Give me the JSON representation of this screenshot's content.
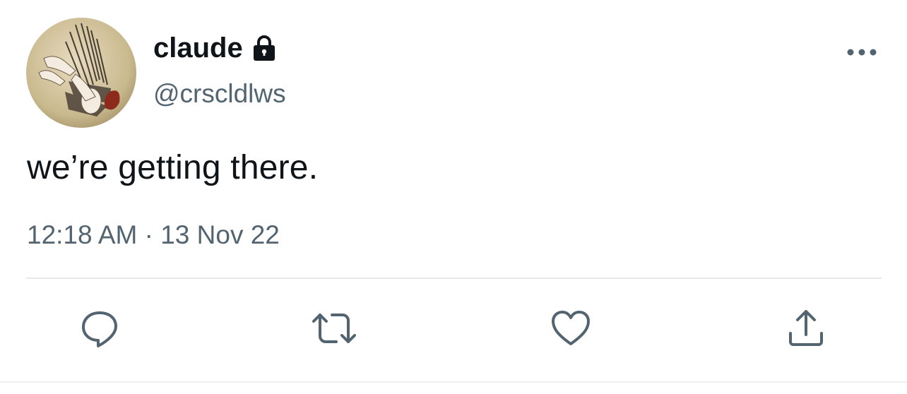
{
  "author": {
    "display_name": "claude",
    "handle": "@crscldlws",
    "protected_icon": "lock-icon",
    "avatar": "avatar-illustration"
  },
  "tweet": {
    "text": "we’re getting there.",
    "timestamp": "12:18 AM · 13 Nov 22"
  },
  "menu": {
    "icon": "more-horizontal-icon"
  },
  "actions": [
    {
      "name": "reply",
      "icon": "reply-icon"
    },
    {
      "name": "retweet",
      "icon": "retweet-icon"
    },
    {
      "name": "like",
      "icon": "heart-icon"
    },
    {
      "name": "share",
      "icon": "share-icon"
    }
  ],
  "colors": {
    "text_primary": "#0f1419",
    "text_secondary": "#536471",
    "icon": "#536471",
    "divider": "#e6e9ec",
    "background": "#ffffff"
  }
}
